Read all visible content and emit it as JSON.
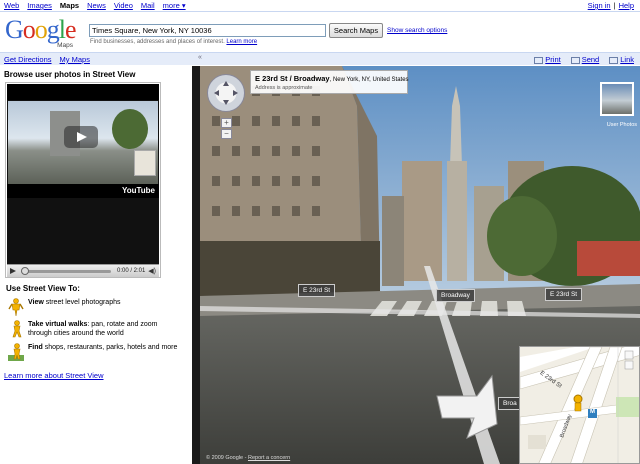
{
  "topnav": {
    "left": [
      "Web",
      "Images",
      "Maps",
      "News",
      "Video",
      "Mail"
    ],
    "current": "Maps",
    "more": "more ▾",
    "sign_in": "Sign in",
    "sep": "|",
    "help": "Help"
  },
  "header": {
    "logo_word": "Google",
    "logo_sub": "Maps",
    "search_value": "Times Square, New York, NY 10036",
    "search_button": "Search Maps",
    "show_options": "Show search options",
    "hint": "Find businesses, addresses and places of interest.",
    "hint_link": "Learn more"
  },
  "toolbar": {
    "get_directions": "Get Directions",
    "my_maps": "My Maps",
    "collapse": "«",
    "print": "Print",
    "send": "Send",
    "link": "Link"
  },
  "sidebar": {
    "title": "Browse user photos in Street View",
    "video": {
      "time": "0:00 / 2:01",
      "brand": "YouTube",
      "progress": 0
    },
    "use_title": "Use Street View To:",
    "features": [
      {
        "bold": "View",
        "rest": " street level photographs",
        "icon": "pegman-icon"
      },
      {
        "bold": "Take virtual walks",
        "rest": ": pan, rotate and zoom through cities around the world",
        "icon": "pegman-walk-icon"
      },
      {
        "bold": "Find",
        "rest": " shops, restaurants, parks, hotels and more",
        "icon": "pegman-find-icon"
      }
    ],
    "learn_more": "Learn more about Street View"
  },
  "streetview": {
    "address_main": "E 23rd St / Broadway",
    "address_city": ", New York, NY, United States",
    "address_note": "Address is approximate",
    "thumb_label": "User Photos",
    "street_labels": [
      "E 23rd St",
      "Broadway",
      "E 23rd St",
      "Broa"
    ],
    "copyright": "© 2009 Google",
    "report": "Report a concern",
    "minimap_labels": [
      "E 23rd St",
      "Broadway",
      "M"
    ]
  },
  "colors": {
    "link": "#0000cc",
    "toolbar_bg": "#e5ecf9",
    "google_blue": "#3366cc",
    "google_red": "#d62d20",
    "google_yellow": "#e2a309",
    "google_green": "#2ea34b"
  }
}
